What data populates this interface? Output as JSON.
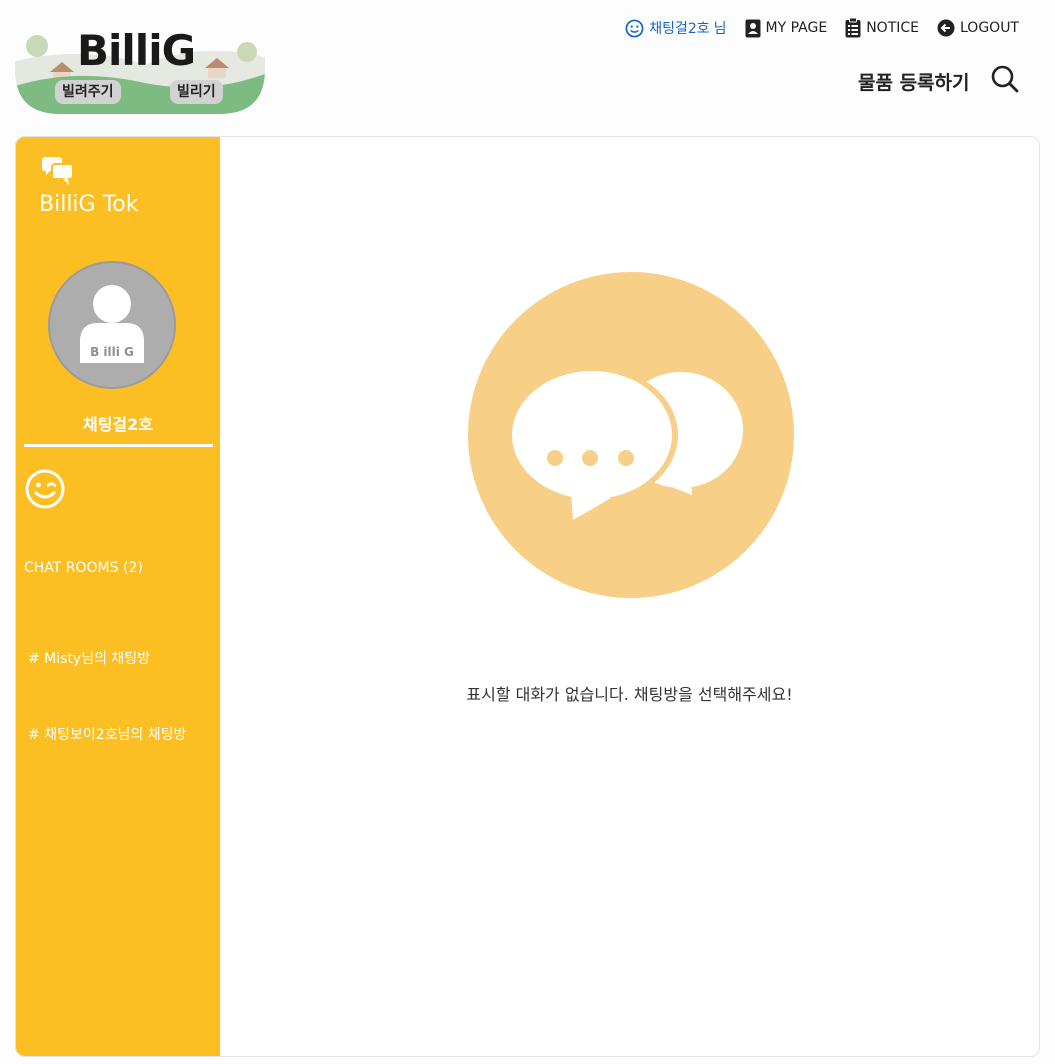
{
  "logo": {
    "wordmark": "BilliG",
    "lend_label": "빌려주기",
    "borrow_label": "빌리기"
  },
  "topnav": {
    "user_name": "채팅걸2호",
    "user_suffix": "님",
    "mypage_label": "MY PAGE",
    "notice_label": "NOTICE",
    "logout_label": "LOGOUT",
    "accent_color": "#1565c0"
  },
  "header": {
    "register_label": "물품 등록하기"
  },
  "sidebar": {
    "title": "BilliG Tok",
    "avatar_label": "B illi G",
    "nickname": "채팅걸2호",
    "rooms_title": "CHAT ROOMS (2)",
    "rooms": [
      "# Misty님의 채팅방",
      "# 채팅보이2호님의 채팅방"
    ],
    "bg_color": "#fbbf23"
  },
  "main": {
    "empty_message": "표시할 대화가 없습니다. 채팅방을 선택해주세요!",
    "icon_color": "#f8cf86"
  }
}
